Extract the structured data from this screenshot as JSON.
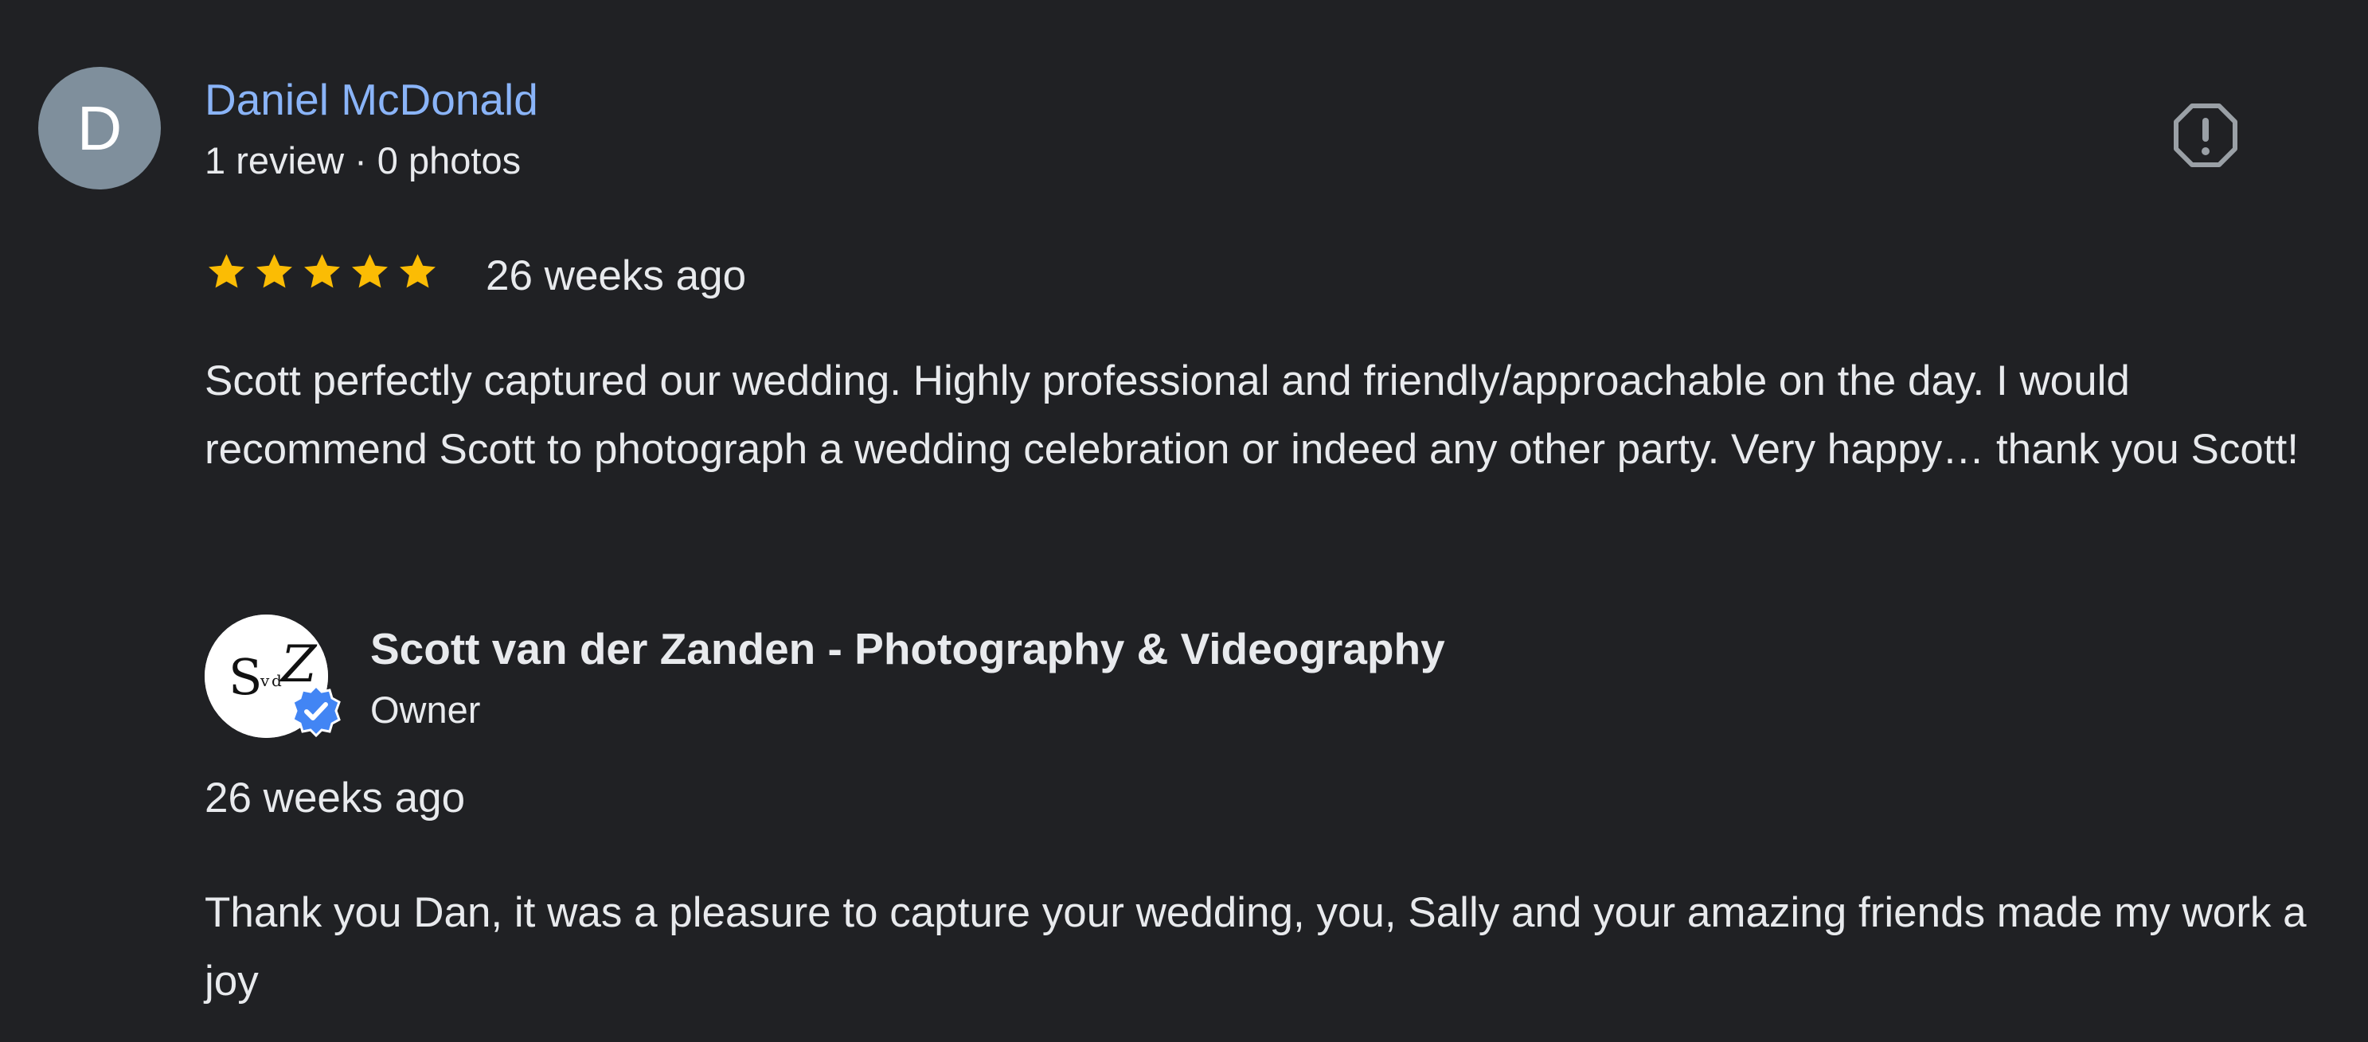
{
  "review": {
    "avatar_letter": "D",
    "avatar_color": "#7f8f9c",
    "reviewer_name": "Daniel McDonald",
    "reviewer_meta": "1 review · 0 photos",
    "report_icon": "report-flag-icon",
    "rating": 5,
    "rating_max": 5,
    "star_color": "#fbbc04",
    "date": "26 weeks ago",
    "text": "Scott perfectly captured our wedding. Highly professional and friendly/approachable on the day. I would recommend Scott to photograph a wedding celebration or indeed any other party. Very happy… thank you Scott!"
  },
  "owner_reply": {
    "logo_text": "SvdZ",
    "verified_icon": "verified-badge-icon",
    "verified_color": "#4285f4",
    "name": "Scott van der Zanden - Photography & Videography",
    "role": "Owner",
    "date": "26 weeks ago",
    "text": "Thank you Dan, it was a pleasure to capture your wedding, you, Sally and your amazing friends made my work a joy"
  },
  "colors": {
    "background": "#202124",
    "link": "#8ab4f8",
    "text": "#e8eaed"
  }
}
